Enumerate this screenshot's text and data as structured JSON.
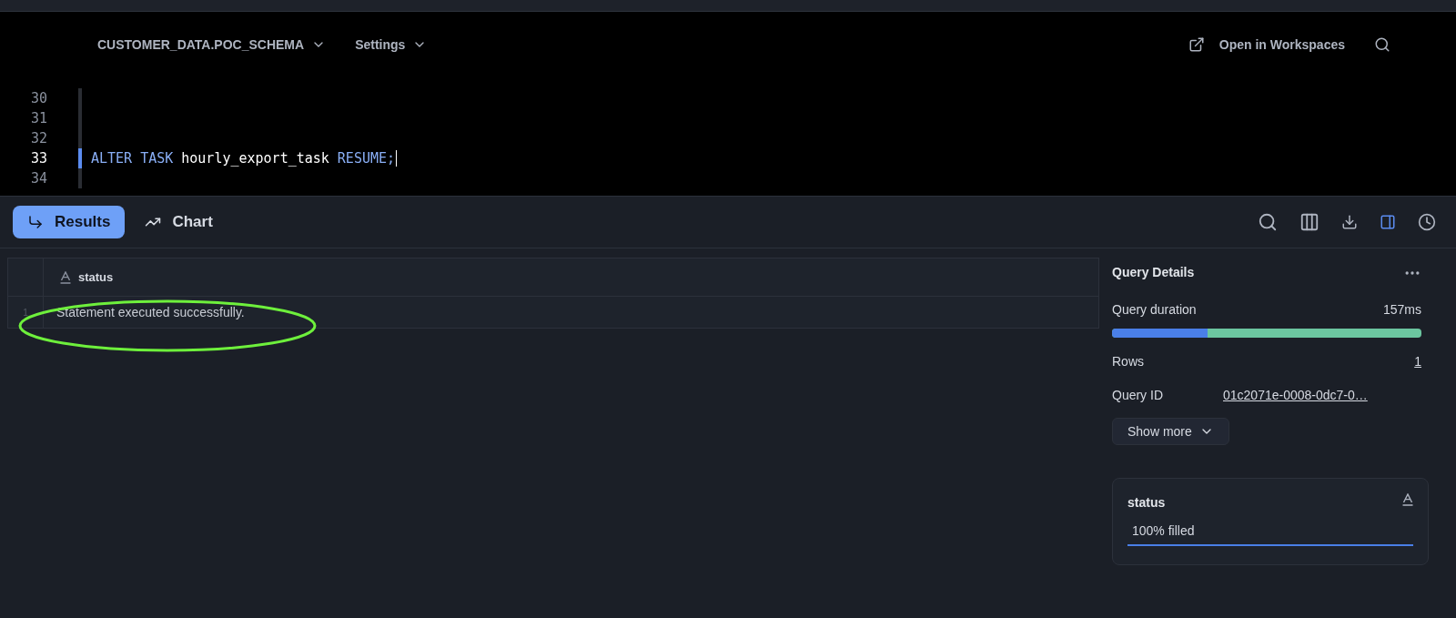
{
  "toolbar": {
    "context": "CUSTOMER_DATA.POC_SCHEMA",
    "settings": "Settings",
    "open_link": "Open in Workspaces"
  },
  "editor": {
    "lines": [
      {
        "number": "30",
        "current": false
      },
      {
        "number": "31",
        "current": false
      },
      {
        "number": "32",
        "current": false
      },
      {
        "number": "33",
        "current": true,
        "tokens": [
          {
            "kind": "keyword",
            "text": "ALTER"
          },
          {
            "kind": "keyword",
            "text": "TASK"
          },
          {
            "kind": "plain",
            "text": "hourly_export_task"
          },
          {
            "kind": "keyword",
            "text": "RESUME;"
          }
        ]
      },
      {
        "number": "34",
        "current": false
      }
    ]
  },
  "tabs": [
    {
      "label": "Results",
      "selected": true
    },
    {
      "label": "Chart",
      "selected": false
    }
  ],
  "table": {
    "columns": [
      "status"
    ],
    "rows": [
      {
        "number": "1",
        "cells": [
          "Statement executed successfully."
        ]
      }
    ]
  },
  "details": {
    "title": "Query Details",
    "duration_label": "Query duration",
    "duration": "157ms",
    "duration_bar": {
      "level": 0.31
    },
    "rows_label": "Rows",
    "rows": "1",
    "id_label": "Query ID",
    "id": "01c2071e-0008-0dc7-0…",
    "show_more": "Show more"
  },
  "column_card": {
    "name": "status",
    "fill_text": "100% filled",
    "level": 1
  }
}
